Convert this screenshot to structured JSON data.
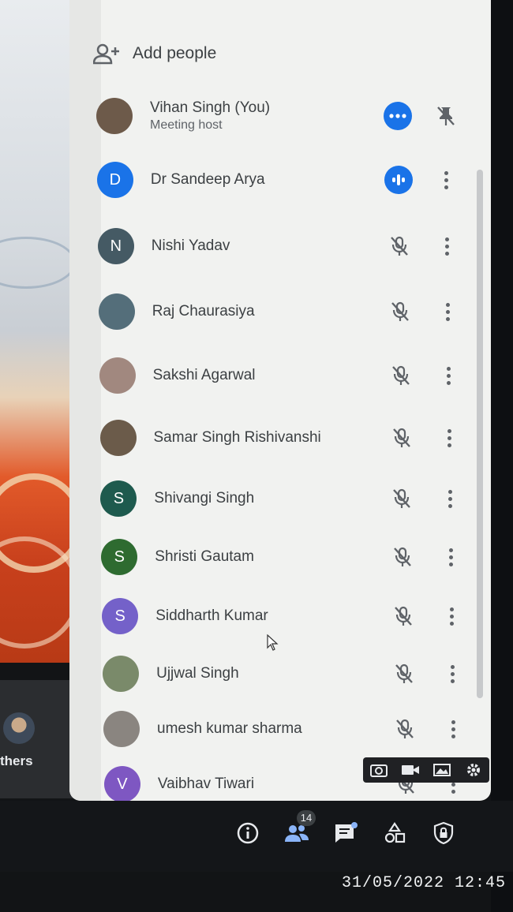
{
  "panel": {
    "add_people_label": "Add people",
    "participants": [
      {
        "name": "Vihan Singh (You)",
        "subtitle": "Meeting host",
        "initial": "",
        "avatar_color": "#6d5a4a",
        "status_icon": "more-horizontal-icon",
        "menu_icon": "pin-off-icon"
      },
      {
        "name": "Dr Sandeep Arya",
        "subtitle": "",
        "initial": "D",
        "avatar_color": "#1a73e8",
        "status_icon": "audio-speaking-icon",
        "menu_icon": "more-vertical-icon"
      },
      {
        "name": "Nishi Yadav",
        "subtitle": "",
        "initial": "N",
        "avatar_color": "#455a64",
        "status_icon": "mic-off-icon",
        "menu_icon": "more-vertical-icon"
      },
      {
        "name": "Raj Chaurasiya",
        "subtitle": "",
        "initial": "",
        "avatar_color": "#546e7a",
        "status_icon": "mic-off-icon",
        "menu_icon": "more-vertical-icon"
      },
      {
        "name": "Sakshi Agarwal",
        "subtitle": "",
        "initial": "",
        "avatar_color": "#a1887f",
        "status_icon": "mic-off-icon",
        "menu_icon": "more-vertical-icon"
      },
      {
        "name": "Samar Singh Rishivanshi",
        "subtitle": "",
        "initial": "",
        "avatar_color": "#6b5b4a",
        "status_icon": "mic-off-icon",
        "menu_icon": "more-vertical-icon"
      },
      {
        "name": "Shivangi Singh",
        "subtitle": "",
        "initial": "S",
        "avatar_color": "#1e5a4e",
        "status_icon": "mic-off-icon",
        "menu_icon": "more-vertical-icon"
      },
      {
        "name": "Shristi Gautam",
        "subtitle": "",
        "initial": "S",
        "avatar_color": "#2e6b30",
        "status_icon": "mic-off-icon",
        "menu_icon": "more-vertical-icon"
      },
      {
        "name": "Siddharth Kumar",
        "subtitle": "",
        "initial": "S",
        "avatar_color": "#7461c9",
        "status_icon": "mic-off-icon",
        "menu_icon": "more-vertical-icon"
      },
      {
        "name": "Ujjwal Singh",
        "subtitle": "",
        "initial": "",
        "avatar_color": "#7a8a6a",
        "status_icon": "mic-off-icon",
        "menu_icon": "more-vertical-icon"
      },
      {
        "name": "umesh kumar sharma",
        "subtitle": "",
        "initial": "",
        "avatar_color": "#8a8580",
        "status_icon": "mic-off-icon",
        "menu_icon": "more-vertical-icon"
      },
      {
        "name": "Vaibhav Tiwari",
        "subtitle": "",
        "initial": "V",
        "avatar_color": "#7e57c2",
        "status_icon": "mic-off-icon",
        "menu_icon": "more-vertical-icon"
      }
    ]
  },
  "others_tile": {
    "label": "thers"
  },
  "toolbar": {
    "icons": [
      "info-icon",
      "people-icon",
      "chat-icon",
      "activities-icon",
      "host-controls-icon"
    ],
    "people_count": "14"
  },
  "camera_bar": {
    "icons": [
      "camera-icon",
      "video-icon",
      "gallery-icon",
      "settings-icon"
    ]
  },
  "timestamp": "31/05/2022 12:45",
  "colors": {
    "accent": "#1a73e8",
    "panel_bg": "#f1f2f0",
    "dark_bg": "#121416"
  }
}
